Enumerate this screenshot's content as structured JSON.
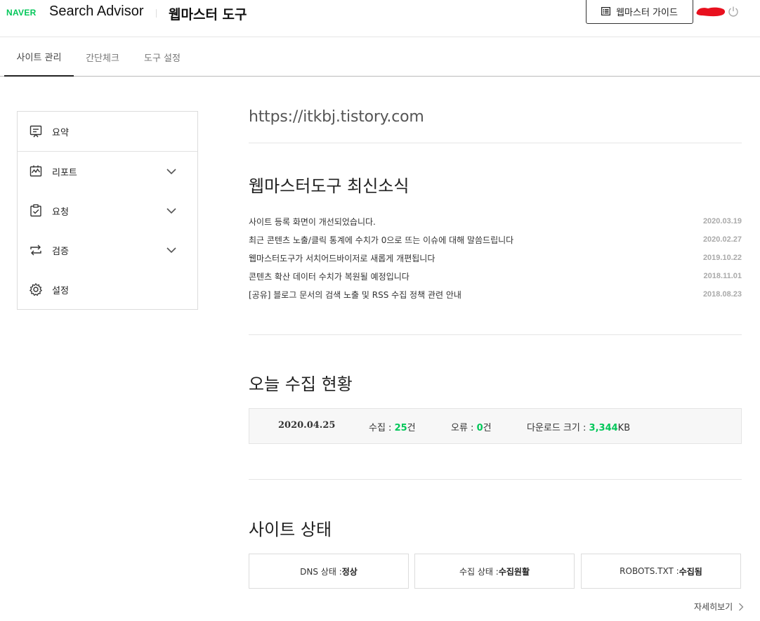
{
  "header": {
    "logo": "NAVER",
    "brand": "Search Advisor",
    "tool_title": "웹마스터 도구",
    "guide_button": "웹마스터 가이드"
  },
  "tabs": [
    {
      "label": "사이트 관리",
      "active": true
    },
    {
      "label": "간단체크",
      "active": false
    },
    {
      "label": "도구 설정",
      "active": false
    }
  ],
  "sidebar": {
    "items": [
      {
        "label": "요약",
        "icon": "summary-board-icon",
        "expandable": false
      },
      {
        "label": "리포트",
        "icon": "report-chart-icon",
        "expandable": true
      },
      {
        "label": "요청",
        "icon": "request-clipboard-icon",
        "expandable": true
      },
      {
        "label": "검증",
        "icon": "verify-arrows-icon",
        "expandable": true
      },
      {
        "label": "설정",
        "icon": "gear-icon",
        "expandable": false
      }
    ]
  },
  "site": {
    "url": "https://itkbj.tistory.com"
  },
  "news": {
    "title": "웹마스터도구 최신소식",
    "items": [
      {
        "title": "사이트 등록 화면이 개선되었습니다.",
        "date": "2020.03.19"
      },
      {
        "title": "최근 콘텐츠 노출/클릭 통계에 수치가 0으로 뜨는 이슈에 대해 말씀드립니다",
        "date": "2020.02.27"
      },
      {
        "title": "웹마스터도구가 서치어드바이저로 새롭게 개편됩니다",
        "date": "2019.10.22"
      },
      {
        "title": "콘텐츠 확산 데이터 수치가 복원될 예정입니다",
        "date": "2018.11.01"
      },
      {
        "title": "[공유] 블로그 문서의 검색 노출 및 RSS 수집 정책 관련 안내",
        "date": "2018.08.23"
      }
    ]
  },
  "crawl": {
    "title": "오늘 수집 현황",
    "date": "2020.04.25",
    "collected_label": "수집 : ",
    "collected_value": "25",
    "collected_unit": "건",
    "error_label": "오류 : ",
    "error_value": "0",
    "error_unit": "건",
    "download_label": "다운로드 크기 : ",
    "download_value": "3,344",
    "download_unit": "KB"
  },
  "site_status": {
    "title": "사이트 상태",
    "items": [
      {
        "label": "DNS 상태 : ",
        "value": "정상"
      },
      {
        "label": "수집 상태 : ",
        "value": "수집원활"
      },
      {
        "label": "ROBOTS.TXT : ",
        "value": "수집됨"
      }
    ],
    "more_link": "자세히보기"
  },
  "colors": {
    "brand_green": "#03c75a",
    "redaction_red": "#e8101e"
  }
}
